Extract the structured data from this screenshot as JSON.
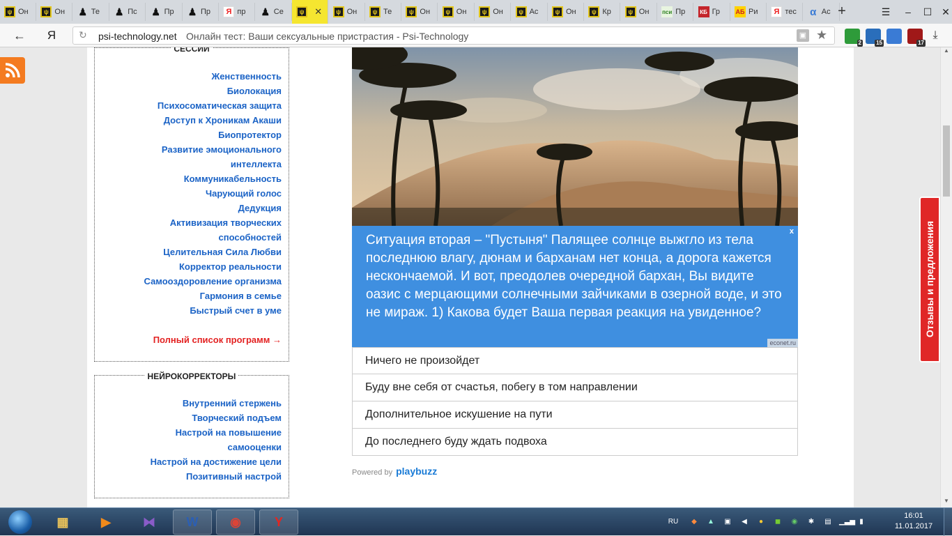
{
  "browser": {
    "tabs": [
      {
        "icon": "psi-icon",
        "title": "Он"
      },
      {
        "icon": "psi-icon",
        "title": "Он"
      },
      {
        "icon": "man-icon",
        "title": "Те"
      },
      {
        "icon": "man-icon",
        "title": "Пс"
      },
      {
        "icon": "man-icon",
        "title": "Пр"
      },
      {
        "icon": "man-icon",
        "title": "Пр"
      },
      {
        "icon": "yandex-icon",
        "title": "пр"
      },
      {
        "icon": "man-icon",
        "title": "Се"
      },
      {
        "icon": "psi-icon",
        "title": "",
        "active": true
      },
      {
        "icon": "psi-icon",
        "title": "Он"
      },
      {
        "icon": "psi-icon",
        "title": "Те"
      },
      {
        "icon": "psi-icon",
        "title": "Он"
      },
      {
        "icon": "psi-icon",
        "title": "Он"
      },
      {
        "icon": "psi-icon",
        "title": "Он"
      },
      {
        "icon": "psi-icon",
        "title": "Ас"
      },
      {
        "icon": "psi-icon",
        "title": "Он"
      },
      {
        "icon": "psi-icon",
        "title": "Кр"
      },
      {
        "icon": "psi-icon",
        "title": "Он"
      },
      {
        "icon": "psi-green-icon",
        "title": "Пр"
      },
      {
        "icon": "kb-icon",
        "title": "Гр"
      },
      {
        "icon": "ab-icon",
        "title": "Ри"
      },
      {
        "icon": "yandex-icon",
        "title": "тес"
      },
      {
        "icon": "alpha-icon",
        "title": "Ас"
      }
    ],
    "active_tab_close": "✕",
    "new_tab": "+",
    "yandex_logo": "Я",
    "url_domain": "psi-technology.net",
    "url_title": "Онлайн тест: Ваши сексуальные пристрастия - Psi-Technology",
    "extensions": [
      {
        "name": "shield-ext-icon",
        "badge": "2",
        "color": "#2e9b3a"
      },
      {
        "name": "clock-ext-icon",
        "badge": "15",
        "color": "#2a6ebb"
      },
      {
        "name": "translate-ext-icon",
        "badge": "",
        "color": "#3a7bd5"
      },
      {
        "name": "ublock-ext-icon",
        "badge": "17",
        "color": "#a01818"
      }
    ]
  },
  "sidebar": {
    "sessions": {
      "title": "СЕССИИ",
      "items": [
        "Женственность",
        "Биолокация",
        "Психосоматическая защита",
        "Доступ к Хроникам Акаши",
        "Биопротектор",
        "Развитие эмоционального",
        "интеллекта",
        "Коммуникабельность",
        "Чарующий голос",
        "Дедукция",
        "Активизация творческих",
        "способностей",
        "Целительная Сила Любви",
        "Корректор реальности",
        "Самооздоровление организма",
        "Гармония в семье",
        "Быстрый счет в уме"
      ],
      "full_list": "Полный список программ →"
    },
    "neurocorrectors": {
      "title": "НЕЙРОКОРРЕКТОРЫ",
      "items": [
        "Внутренний стержень",
        "Творческий подъем",
        "Настрой на повышение",
        "самооценки",
        "Настрой на достижение цели",
        "Позитивный настрой"
      ]
    }
  },
  "quiz": {
    "question": "Ситуация вторая – \"Пустыня\" Палящее солнце выжгло из тела последнюю влагу, дюнам и барханам нет конца, а дорога кажется нескончаемой. И вот, преодолев очередной бархан, Вы видите оазис с мерцающими солнечными зайчиками в озерной воде, и это не мираж. 1) Какова будет Ваша первая реакция на увиденное?",
    "close": "x",
    "credit": "econet.ru",
    "answers": [
      "Ничего не произойдет",
      "Буду вне себя от счастья, побегу в том направлении",
      "Дополнительное искушение на пути",
      "До последнего буду ждать подвоха"
    ],
    "powered_by": "Powered by",
    "powered_brand": "playbuzz"
  },
  "feedback_tab": "Отзывы и предложения",
  "taskbar": {
    "apps": [
      {
        "name": "explorer-icon",
        "color": "#e8c15a"
      },
      {
        "name": "media-player-icon",
        "color": "#f08a1c"
      },
      {
        "name": "visual-studio-icon",
        "color": "#8a5cc8"
      },
      {
        "name": "word-icon",
        "color": "#2b5fb4"
      },
      {
        "name": "chrome-icon",
        "color": "#db4437"
      },
      {
        "name": "yandex-browser-icon",
        "color": "#e52620"
      }
    ],
    "lang": "RU",
    "time": "16:01",
    "date": "11.01.2017"
  }
}
